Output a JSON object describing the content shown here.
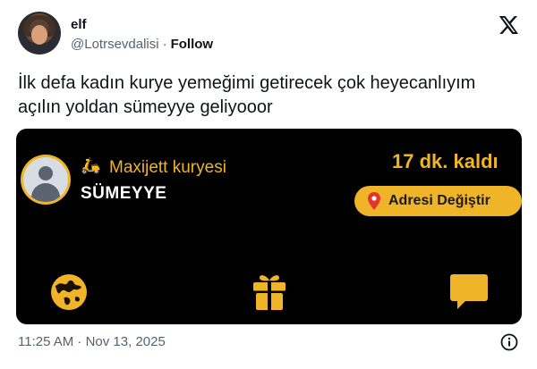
{
  "author": {
    "name": "elf",
    "handle": "@Lotrsevdalisi",
    "separator": "·",
    "follow_label": "Follow",
    "avatar_icon": "profile-photo"
  },
  "platform_icon": "x-logo-icon",
  "tweet": {
    "line1": "İlk defa kadın kurye yemeğimi getirecek çok heyecanlıyım",
    "line2": "açılın yoldan sümeyye geliyooor"
  },
  "card": {
    "courier_label": "Maxijett kuryesi",
    "courier_name": "SÜMEYYE",
    "scooter_glyph": "🛵",
    "eta": "17 dk. kaldı",
    "address_button_label": "Adresi Değiştir",
    "icons": [
      "globe-icon",
      "gift-icon",
      "chat-icon"
    ],
    "colors": {
      "accent": "#f0b429",
      "background": "#000000",
      "text": "#ffffff"
    }
  },
  "timestamp": "11:25 AM · Nov 13, 2025",
  "info_icon": "info-icon"
}
